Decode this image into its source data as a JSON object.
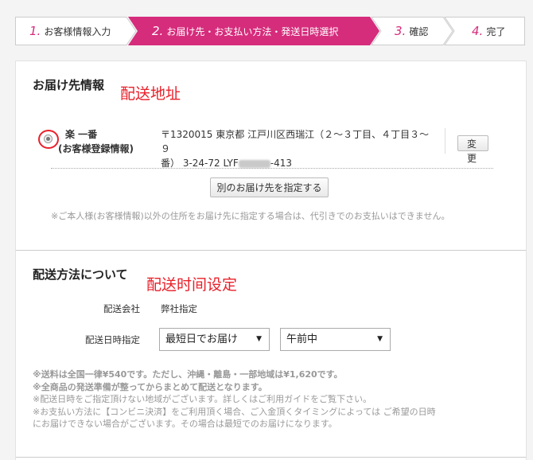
{
  "steps": [
    {
      "num": "1.",
      "label": "お客様情報入力"
    },
    {
      "num": "2.",
      "label": "お届け先・お支払い方法・発送日時選択"
    },
    {
      "num": "3.",
      "label": "確認"
    },
    {
      "num": "4.",
      "label": "完了"
    }
  ],
  "colors": {
    "accent": "#d62c7c",
    "annotation": "#e8202a"
  },
  "delivery_address": {
    "title": "お届け先情報",
    "annotation": "配送地址",
    "name_line1": "楽 一番",
    "name_line2": "(お客様登録情報)",
    "address_line1": "〒1320015 東京都 江戸川区西瑞江（２～３丁目、４丁目３～９",
    "address_line2_prefix": "番） 3-24-72 LYF",
    "address_line2_suffix": "-413",
    "change_button": "変更",
    "other_address_button": "別のお届け先を指定する",
    "note": "※ご本人様(お客様情報)以外の住所をお届け先に指定する場合は、代引きでのお支払いはできません。"
  },
  "shipping": {
    "title": "配送方法について",
    "annotation": "配送时间设定",
    "company_label": "配送会社",
    "company_value": "弊社指定",
    "datetime_label": "配送日時指定",
    "date_select": "最短日でお届け",
    "time_select": "午前中",
    "notes_bold": [
      "※送料は全国一律¥540です。ただし、沖縄・離島・一部地域は¥1,620です。",
      "※全商品の発送準備が整ってからまとめて配送となります。"
    ],
    "notes": [
      "※配送日時をご指定頂けない地域がございます。詳しくはご利用ガイドをご覧下さい。",
      "※お支払い方法に【コンビニ決済】をご利用頂く場合、ご入金頂くタイミングによっては ご希望の日時",
      "にお届けできない場合がございます。その場合は最短でのお届けになります。"
    ]
  }
}
